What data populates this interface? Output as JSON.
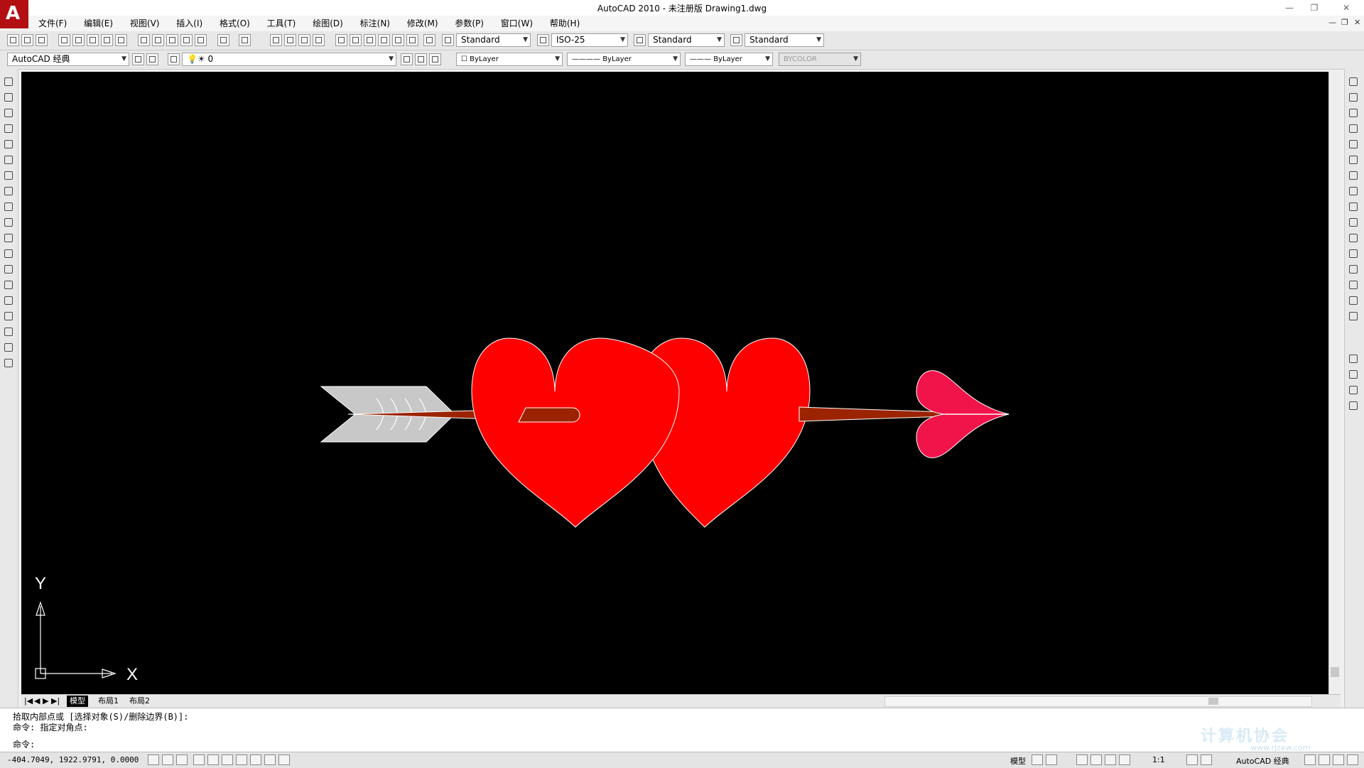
{
  "window": {
    "title": "AutoCAD 2010 - 未注册版      Drawing1.dwg",
    "logo_glyph": "A",
    "controls": [
      "—",
      "❐",
      "✕"
    ],
    "doc_controls": [
      "—",
      "❐",
      "✕"
    ]
  },
  "menu": [
    "文件(F)",
    "编辑(E)",
    "视图(V)",
    "插入(I)",
    "格式(O)",
    "工具(T)",
    "绘图(D)",
    "标注(N)",
    "修改(M)",
    "参数(P)",
    "窗口(W)",
    "帮助(H)"
  ],
  "styles_toolbar": {
    "text_style": "Standard",
    "dim_style": "ISO-25",
    "table_style": "Standard",
    "mleader_style": "Standard"
  },
  "workspace_toolbar": {
    "workspace": "AutoCAD 经典",
    "layer": "0",
    "color": "ByLayer",
    "linetype": "ByLayer",
    "lineweight": "ByLayer",
    "plotstyle": "BYCOLOR"
  },
  "drawing": {
    "ucs_x_label": "X",
    "ucs_y_label": "Y",
    "colors": {
      "background": "#000000",
      "heart": "#ff0000",
      "arrow_head": "#f0144a",
      "shaft": "#9b2300",
      "fletching": "#c8c8c8",
      "outline": "#ffffff"
    }
  },
  "layout_tabs": [
    "模型",
    "布局1",
    "布局2"
  ],
  "tab_nav": [
    "|◀",
    "◀",
    "▶",
    "▶|"
  ],
  "command_window": {
    "line1": "拾取内部点或 [选择对象(S)/删除边界(B)]:",
    "line2": "命令: 指定对角点:",
    "prompt": "命令:"
  },
  "status_bar": {
    "coordinates": "-404.7049, 1922.9791, 0.0000",
    "model_label": "模型",
    "annotation_scale": "1:1",
    "workspace": "AutoCAD 经典"
  },
  "watermark": {
    "text": "计算机协会",
    "url": "www.rjzxw.com"
  }
}
